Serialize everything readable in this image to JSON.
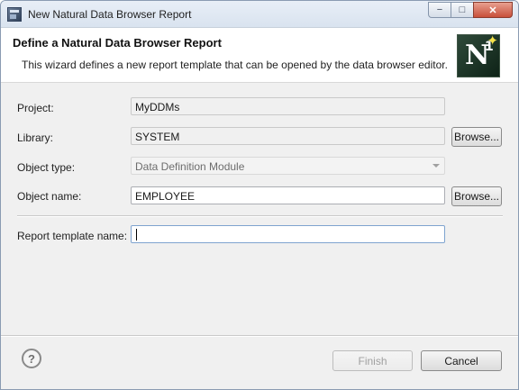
{
  "window": {
    "title": "New Natural Data Browser Report",
    "minimize_glyph": "−",
    "maximize_glyph": "□",
    "close_glyph": "✕"
  },
  "header": {
    "title": "Define a Natural Data Browser Report",
    "description": "This wizard defines a new report template that can be opened by the data browser editor.",
    "banner": {
      "letter": "N",
      "superscript": "1",
      "star": "✦"
    }
  },
  "form": {
    "project": {
      "label": "Project:",
      "value": "MyDDMs"
    },
    "library": {
      "label": "Library:",
      "value": "SYSTEM",
      "browse_label": "Browse..."
    },
    "object_type": {
      "label": "Object type:",
      "value": "Data Definition Module"
    },
    "object_name": {
      "label": "Object name:",
      "value": "EMPLOYEE",
      "browse_label": "Browse..."
    },
    "report_template_name": {
      "label": "Report template name:",
      "value": ""
    }
  },
  "footer": {
    "help_glyph": "?",
    "finish_label": "Finish",
    "cancel_label": "Cancel"
  }
}
